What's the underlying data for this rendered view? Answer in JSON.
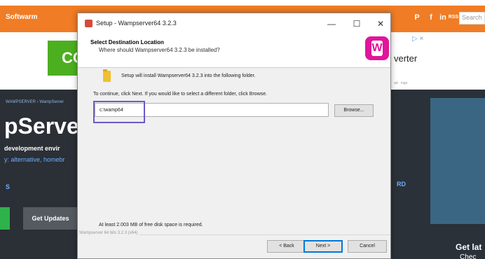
{
  "background_site": {
    "site_name": "Softwarm",
    "social": [
      {
        "icon": "pinterest-icon",
        "glyph": "P"
      },
      {
        "icon": "facebook-icon",
        "glyph": "f"
      },
      {
        "icon": "linkedin-icon",
        "glyph": "in"
      },
      {
        "icon": "rss-icon",
        "glyph": "RSS"
      }
    ],
    "search_placeholder": "Search",
    "ad": {
      "green_text": "CO",
      "right_logo": "▷ ×",
      "right_text": "verter",
      "right_small": "ad · logo"
    },
    "hero": {
      "breadcrumb": "WAMPSERVER › WampServer",
      "title": "pServer",
      "subtitle": "development envir",
      "tags": "y: alternative, homebr",
      "left_mark": "S",
      "mid_mark": "RD",
      "updates_button": "Get Updates",
      "right_caption": "Get lat",
      "right_sub": "Chec"
    }
  },
  "dialog": {
    "title": "Setup - Wampserver64 3.2.3",
    "header_title": "Select Destination Location",
    "header_subtitle": "Where should Wampserver64 3.2.3 be installed?",
    "install_message": "Setup will install Wampserver64 3.2.3 into the following folder.",
    "continue_message": "To continue, click Next. If you would like to select a different folder, click Browse.",
    "path_value": "c:\\wamp64",
    "browse_label": "Browse...",
    "space_message": "At least 2.003 MB of free disk space is required.",
    "brand_text": "Wampserver 64 bits 3.2.3 (x64)",
    "back_label": "< Back",
    "next_label": "Next >",
    "cancel_label": "Cancel",
    "minimize_glyph": "—",
    "maximize_glyph": "☐",
    "close_glyph": "✕",
    "logo_letter": "W"
  },
  "colors": {
    "site_accent": "#f07c25",
    "highlight": "#6a5ac8",
    "wamp_logo": "#e0159c"
  }
}
